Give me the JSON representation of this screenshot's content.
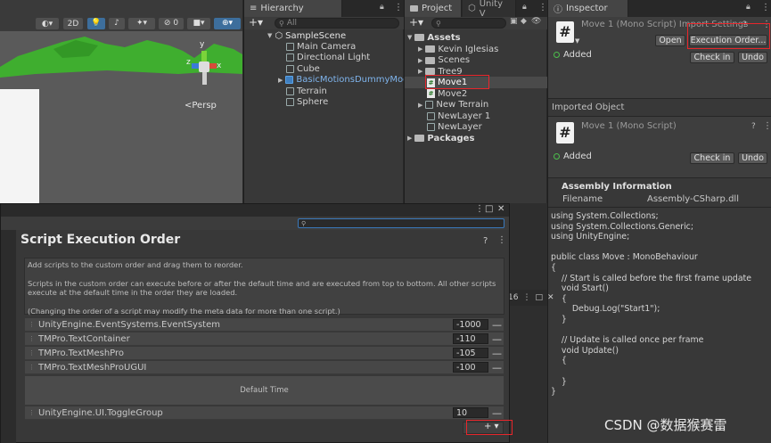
{
  "scene": {
    "toolbar": {
      "mode_2d": "2D"
    },
    "persp_label": "<Persp",
    "gizmo": {
      "y": "y",
      "x": "x",
      "z": "z"
    }
  },
  "hierarchy": {
    "tab": "Hierarchy",
    "search_placeholder": "All",
    "scene_name": "SampleScene",
    "items": [
      "Main Camera",
      "Directional Light",
      "Cube",
      "BasicMotionsDummyMode",
      "Terrain",
      "Sphere"
    ]
  },
  "project": {
    "tab_project": "Project",
    "tab_unity": "Unity V",
    "root": "Assets",
    "items": [
      "Kevin Iglesias",
      "Scenes",
      "Tree9",
      "Move1",
      "Move2",
      "New Terrain",
      "NewLayer 1",
      "NewLayer"
    ],
    "packages": "Packages",
    "badge": "16"
  },
  "inspector": {
    "tab": "Inspector",
    "header_title": "Move 1 (Mono Script) Import Settings",
    "open_btn": "Open",
    "exec_order_btn": "Execution Order...",
    "added": "Added",
    "check_in": "Check in",
    "undo": "Undo",
    "imported_object": "Imported Object",
    "obj_title": "Move 1 (Mono Script)",
    "added2": "Added",
    "check_in2": "Check in",
    "undo2": "Undo",
    "assembly_info": "Assembly Information",
    "filename_label": "Filename",
    "filename_value": "Assembly-CSharp.dll",
    "code": "using System.Collections;\nusing System.Collections.Generic;\nusing UnityEngine;\n\npublic class Move : MonoBehaviour\n{\n    // Start is called before the first frame update\n    void Start()\n    {\n        Debug.Log(\"Start1\");\n    }\n\n    // Update is called once per frame\n    void Update()\n    {\n\n    }\n}"
  },
  "seo": {
    "title": "Script Execution Order",
    "desc1": "Add scripts to the custom order and drag them to reorder.",
    "desc2": "Scripts in the custom order can execute before or after the default time and are executed from top to bottom. All other scripts execute at the default time in the order they are loaded.",
    "desc3": "(Changing the order of a script may modify the meta data for more than one script.)",
    "rows": [
      {
        "name": "UnityEngine.EventSystems.EventSystem",
        "value": "-1000"
      },
      {
        "name": "TMPro.TextContainer",
        "value": "-110"
      },
      {
        "name": "TMPro.TextMeshPro",
        "value": "-105"
      },
      {
        "name": "TMPro.TextMeshProUGUI",
        "value": "-100"
      }
    ],
    "default_time": "Default Time",
    "after_rows": [
      {
        "name": "UnityEngine.UI.ToggleGroup",
        "value": "10"
      }
    ],
    "add_label": "+ ▾"
  },
  "watermark": "CSDN @数据猴赛雷",
  "colors": {
    "accent_red": "#e8262b",
    "selection_blue": "#2c5d87",
    "terrain_green": "#3fae2f"
  }
}
